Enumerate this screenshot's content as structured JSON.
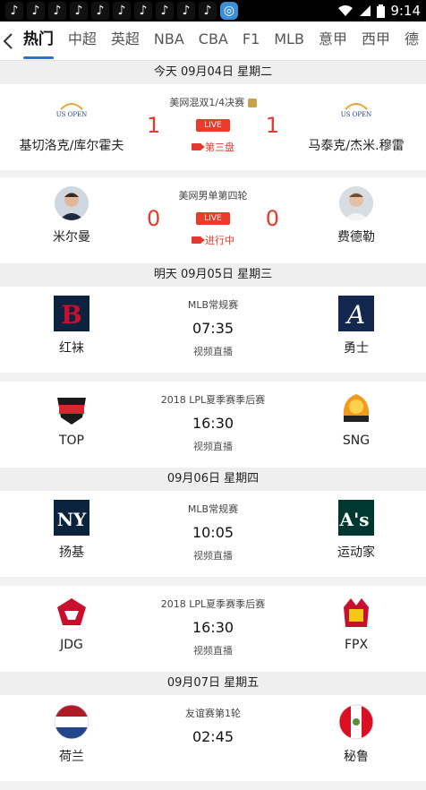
{
  "statusbar": {
    "time": "9:14",
    "app_icon_count": 11
  },
  "tabs": [
    "热门",
    "中超",
    "英超",
    "NBA",
    "CBA",
    "F1",
    "MLB",
    "意甲",
    "西甲",
    "德"
  ],
  "active_tab": "热门",
  "colors": {
    "accent": "#2f6fd1",
    "live_red": "#e23b2e"
  },
  "sections": [
    {
      "date": "今天 09月04日 星期二",
      "matches": [
        {
          "left": "基切洛克/库尔霍夫",
          "right": "马泰克/杰米.穆雷",
          "competition": "美网混双1/4决赛",
          "left_score": "1",
          "right_score": "1",
          "live_badge": "LIVE",
          "status": "第三盘"
        },
        {
          "left": "米尔曼",
          "right": "费德勒",
          "competition": "美网男单第四轮",
          "left_score": "0",
          "right_score": "0",
          "live_badge": "LIVE",
          "status": "进行中"
        }
      ]
    },
    {
      "date": "明天 09月05日 星期三",
      "matches": [
        {
          "left": "红袜",
          "right": "勇士",
          "competition": "MLB常规赛",
          "time": "07:35",
          "sub": "视频直播"
        },
        {
          "left": "TOP",
          "right": "SNG",
          "competition": "2018 LPL夏季赛季后赛",
          "time": "16:30",
          "sub": "视频直播"
        }
      ]
    },
    {
      "date": "09月06日 星期四",
      "matches": [
        {
          "left": "扬基",
          "right": "运动家",
          "competition": "MLB常规赛",
          "time": "10:05",
          "sub": "视频直播"
        },
        {
          "left": "JDG",
          "right": "FPX",
          "competition": "2018 LPL夏季赛季后赛",
          "time": "16:30",
          "sub": "视频直播"
        }
      ]
    },
    {
      "date": "09月07日 星期五",
      "matches": [
        {
          "left": "荷兰",
          "right": "秘鲁",
          "competition": "友谊赛第1轮",
          "time": "02:45",
          "sub": ""
        }
      ]
    }
  ]
}
